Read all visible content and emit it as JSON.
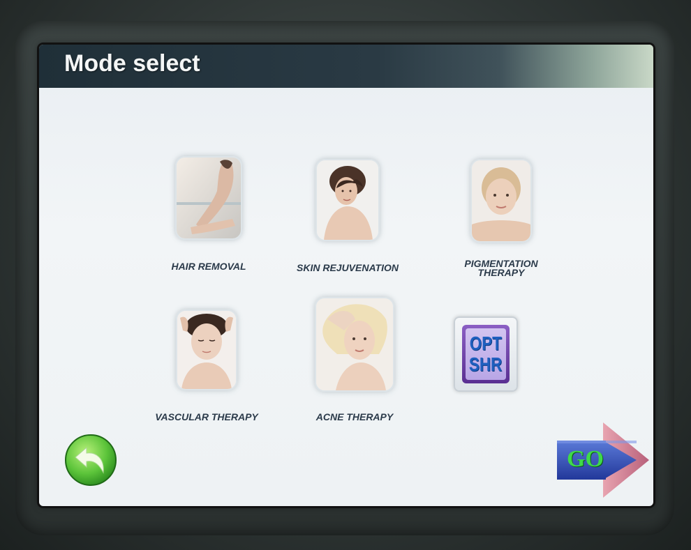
{
  "screen": {
    "title": "Mode select"
  },
  "modes": [
    {
      "label": "HAIR REMOVAL"
    },
    {
      "label": "SKIN REJUVENATION"
    },
    {
      "label_line1": "PIGMENTATION",
      "label_line2": "THERAPY"
    },
    {
      "label": "VASCULAR THERAPY"
    },
    {
      "label": "ACNE THERAPY"
    },
    {
      "icon_line1": "OPT",
      "icon_line2": "SHR"
    }
  ],
  "controls": {
    "go_label": "GO",
    "back_icon": "back-arrow-icon"
  },
  "colors": {
    "go_text": "#3fd94a",
    "go_arrow_blue": "#2f4fb8",
    "go_arrow_pink": "#d88a9a",
    "back_green": "#5cc43a",
    "opt_purple": "#6a3fa0",
    "opt_text": "#1f5fbf"
  }
}
